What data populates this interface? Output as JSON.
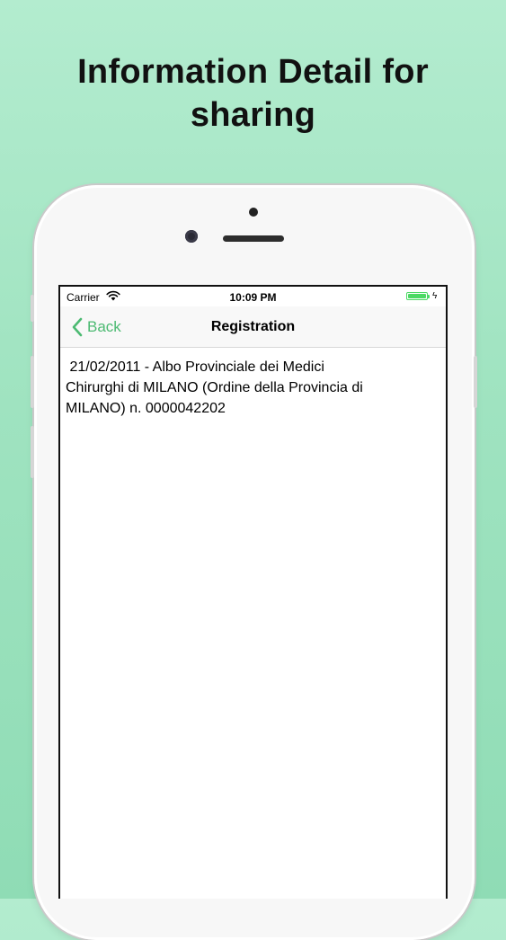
{
  "promo": {
    "title_line1": "Information Detail for",
    "title_line2": "sharing"
  },
  "status_bar": {
    "carrier": "Carrier",
    "time": "10:09 PM",
    "battery_level": 1.0,
    "wifi_icon": "wifi-icon",
    "charging_icon": "bolt-icon"
  },
  "nav_bar": {
    "back_label": "Back",
    "back_icon": "chevron-left-icon",
    "title": "Registration"
  },
  "detail": {
    "text": " 21/02/2011 - Albo Provinciale dei Medici\nChirurghi di MILANO (Ordine della Provincia di\nMILANO) n. 0000042202"
  },
  "colors": {
    "accent": "#4cba72",
    "battery": "#4cd964",
    "background": "#a6e6c4"
  }
}
